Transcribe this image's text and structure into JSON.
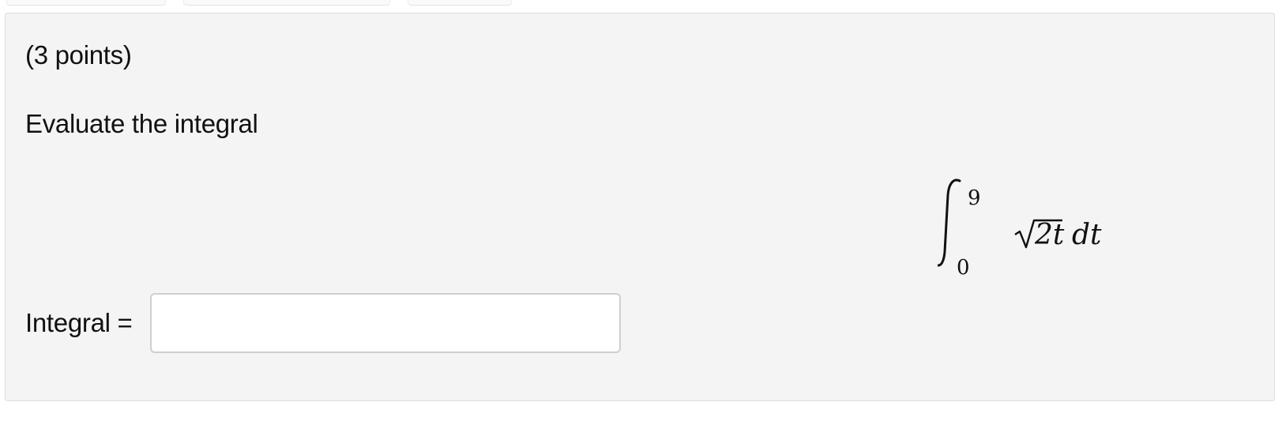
{
  "problem": {
    "points_label": "(3 points)",
    "prompt": "Evaluate the integral",
    "integral": {
      "upper_limit": "9",
      "lower_limit": "0",
      "radicand": "2t",
      "differential": "dt"
    },
    "answer": {
      "label": "Integral =",
      "value": "",
      "placeholder": ""
    }
  }
}
